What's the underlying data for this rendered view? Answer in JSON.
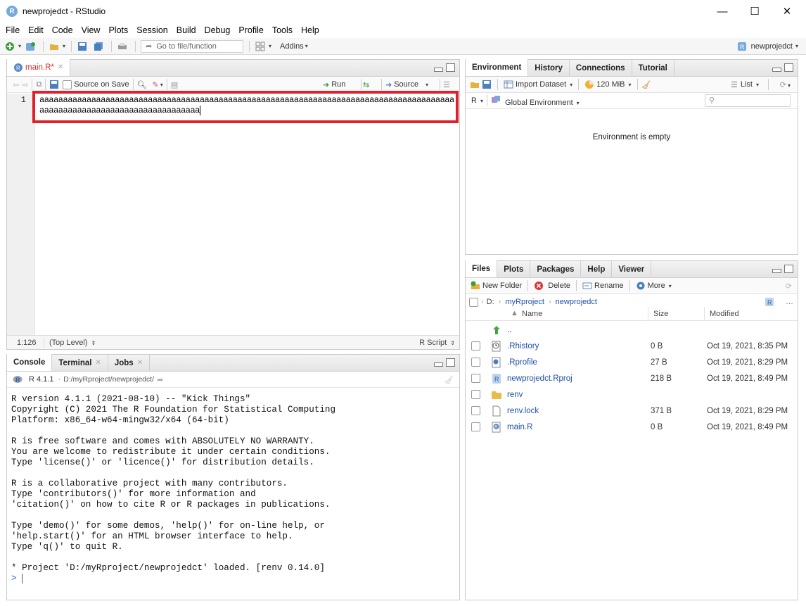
{
  "window": {
    "title": "newprojedct - RStudio",
    "minimize": "—",
    "maximize": "☐",
    "close": "✕"
  },
  "menu": [
    "File",
    "Edit",
    "Code",
    "View",
    "Plots",
    "Session",
    "Build",
    "Debug",
    "Profile",
    "Tools",
    "Help"
  ],
  "toolbar": {
    "goto_placeholder": "Go to file/function",
    "addins": "Addins",
    "project": "newprojedct"
  },
  "editor": {
    "tab_label": "main.R*",
    "source_on_save": "Source on Save",
    "run": "Run",
    "source": "Source",
    "line_number": "1",
    "code": "aaaaaaaaaaaaaaaaaaaaaaaaaaaaaaaaaaaaaaaaaaaaaaaaaaaaaaaaaaaaaaaaaaaaaaaaaaaaaaaaaaaaaaaaaaaaaaaaaaaaaaaaaaaaaaaaaaaaaaaaaa",
    "cursor_pos": "1:126",
    "scope": "(Top Level)",
    "file_type": "R Script"
  },
  "console": {
    "tabs": [
      "Console",
      "Terminal",
      "Jobs"
    ],
    "r_version": "R 4.1.1",
    "path": "D:/myRproject/newprojedct/",
    "output": "R version 4.1.1 (2021-08-10) -- \"Kick Things\"\nCopyright (C) 2021 The R Foundation for Statistical Computing\nPlatform: x86_64-w64-mingw32/x64 (64-bit)\n\nR is free software and comes with ABSOLUTELY NO WARRANTY.\nYou are welcome to redistribute it under certain conditions.\nType 'license()' or 'licence()' for distribution details.\n\nR is a collaborative project with many contributors.\nType 'contributors()' for more information and\n'citation()' on how to cite R or R packages in publications.\n\nType 'demo()' for some demos, 'help()' for on-line help, or\n'help.start()' for an HTML browser interface to help.\nType 'q()' to quit R.\n\n* Project 'D:/myRproject/newprojedct' loaded. [renv 0.14.0]",
    "prompt": "> "
  },
  "environment": {
    "tabs": [
      "Environment",
      "History",
      "Connections",
      "Tutorial"
    ],
    "import_dataset": "Import Dataset",
    "memory": "120 MiB",
    "view_mode": "List",
    "language": "R",
    "scope": "Global Environment",
    "empty_message": "Environment is empty"
  },
  "files": {
    "tabs": [
      "Files",
      "Plots",
      "Packages",
      "Help",
      "Viewer"
    ],
    "new_folder": "New Folder",
    "delete": "Delete",
    "rename": "Rename",
    "more": "More",
    "breadcrumb": [
      "D:",
      "myRproject",
      "newprojedct"
    ],
    "columns": {
      "name": "Name",
      "size": "Size",
      "modified": "Modified"
    },
    "rows": [
      {
        "name": "..",
        "size": "",
        "modified": "",
        "icon": "up-arrow-icon"
      },
      {
        "name": ".Rhistory",
        "size": "0 B",
        "modified": "Oct 19, 2021, 8:35 PM",
        "icon": "rhistory-icon"
      },
      {
        "name": ".Rprofile",
        "size": "27 B",
        "modified": "Oct 19, 2021, 8:29 PM",
        "icon": "rprofile-icon"
      },
      {
        "name": "newprojedct.Rproj",
        "size": "218 B",
        "modified": "Oct 19, 2021, 8:49 PM",
        "icon": "rproj-icon"
      },
      {
        "name": "renv",
        "size": "",
        "modified": "",
        "icon": "folder-icon"
      },
      {
        "name": "renv.lock",
        "size": "371 B",
        "modified": "Oct 19, 2021, 8:29 PM",
        "icon": "file-icon"
      },
      {
        "name": "main.R",
        "size": "0 B",
        "modified": "Oct 19, 2021, 8:49 PM",
        "icon": "r-file-icon"
      }
    ]
  },
  "colors": {
    "accent": "#75aadb",
    "highlight": "#e0202a",
    "link": "#1f4fa8"
  }
}
